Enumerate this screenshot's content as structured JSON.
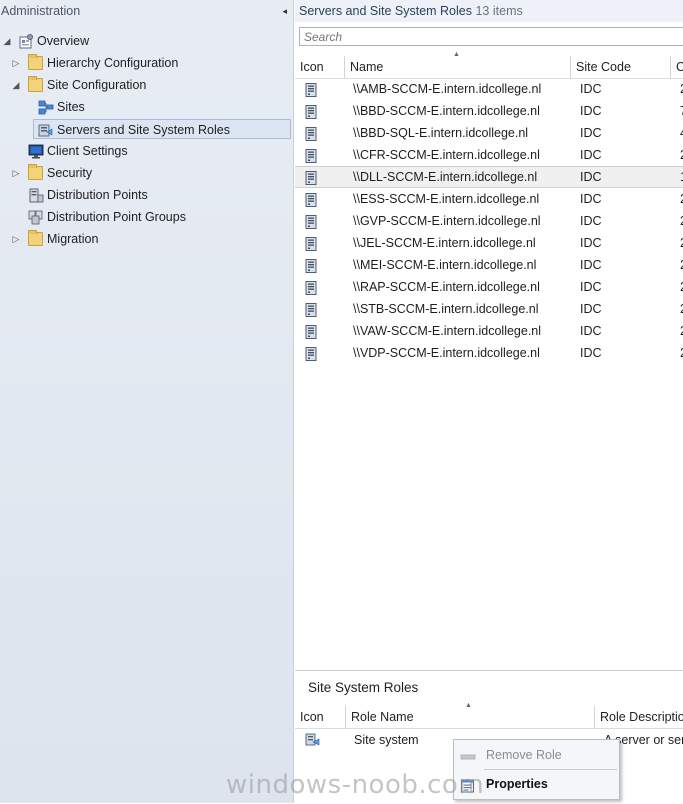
{
  "nav": {
    "header": "Administration",
    "collapse_glyph": "◂",
    "items": [
      {
        "label": "Overview",
        "icon": "overview-icon",
        "arrow": "◢"
      },
      {
        "label": "Hierarchy Configuration",
        "icon": "folder-icon",
        "arrow": "▷"
      },
      {
        "label": "Site Configuration",
        "icon": "folder-icon",
        "arrow": "◢"
      },
      {
        "label": "Sites",
        "icon": "sites-icon",
        "arrow": ""
      },
      {
        "label": "Servers and Site System Roles",
        "icon": "servers-roles-icon",
        "arrow": ""
      },
      {
        "label": "Client Settings",
        "icon": "monitor-icon",
        "arrow": ""
      },
      {
        "label": "Security",
        "icon": "folder-icon",
        "arrow": "▷"
      },
      {
        "label": "Distribution Points",
        "icon": "distribution-point-icon",
        "arrow": ""
      },
      {
        "label": "Distribution Point Groups",
        "icon": "distribution-point-groups-icon",
        "arrow": ""
      },
      {
        "label": "Migration",
        "icon": "folder-icon",
        "arrow": "▷"
      }
    ]
  },
  "main": {
    "title": "Servers and Site System Roles",
    "count": "13 items",
    "search_placeholder": "Search",
    "sort_glyph": "▲",
    "columns": [
      "Icon",
      "Name",
      "Site Code",
      "C"
    ],
    "rows": [
      {
        "name": "\\\\AMB-SCCM-E.intern.idcollege.nl",
        "site_code": "IDC",
        "extra": "2"
      },
      {
        "name": "\\\\BBD-SCCM-E.intern.idcollege.nl",
        "site_code": "IDC",
        "extra": "7"
      },
      {
        "name": "\\\\BBD-SQL-E.intern.idcollege.nl",
        "site_code": "IDC",
        "extra": "4"
      },
      {
        "name": "\\\\CFR-SCCM-E.intern.idcollege.nl",
        "site_code": "IDC",
        "extra": "2"
      },
      {
        "name": "\\\\DLL-SCCM-E.intern.idcollege.nl",
        "site_code": "IDC",
        "extra": "1"
      },
      {
        "name": "\\\\ESS-SCCM-E.intern.idcollege.nl",
        "site_code": "IDC",
        "extra": "2"
      },
      {
        "name": "\\\\GVP-SCCM-E.intern.idcollege.nl",
        "site_code": "IDC",
        "extra": "2"
      },
      {
        "name": "\\\\JEL-SCCM-E.intern.idcollege.nl",
        "site_code": "IDC",
        "extra": "2"
      },
      {
        "name": "\\\\MEI-SCCM-E.intern.idcollege.nl",
        "site_code": "IDC",
        "extra": "2"
      },
      {
        "name": "\\\\RAP-SCCM-E.intern.idcollege.nl",
        "site_code": "IDC",
        "extra": "2"
      },
      {
        "name": "\\\\STB-SCCM-E.intern.idcollege.nl",
        "site_code": "IDC",
        "extra": "2"
      },
      {
        "name": "\\\\VAW-SCCM-E.intern.idcollege.nl",
        "site_code": "IDC",
        "extra": "2"
      },
      {
        "name": "\\\\VDP-SCCM-E.intern.idcollege.nl",
        "site_code": "IDC",
        "extra": "2"
      }
    ]
  },
  "details": {
    "title": "Site System Roles",
    "columns": [
      "Icon",
      "Role Name",
      "Role Description"
    ],
    "row": {
      "role_name": "Site system",
      "description": "A server or serv"
    }
  },
  "context_menu": {
    "items": [
      {
        "label": "Remove Role",
        "enabled": false
      },
      {
        "label": "Properties",
        "enabled": true
      }
    ]
  },
  "watermark": "windows-noob.com",
  "colors": {
    "nav_bg": "#e3e9f1",
    "selection": "#dce6f2",
    "header_text": "#2a3f5f",
    "folder": "#f2d37a"
  }
}
